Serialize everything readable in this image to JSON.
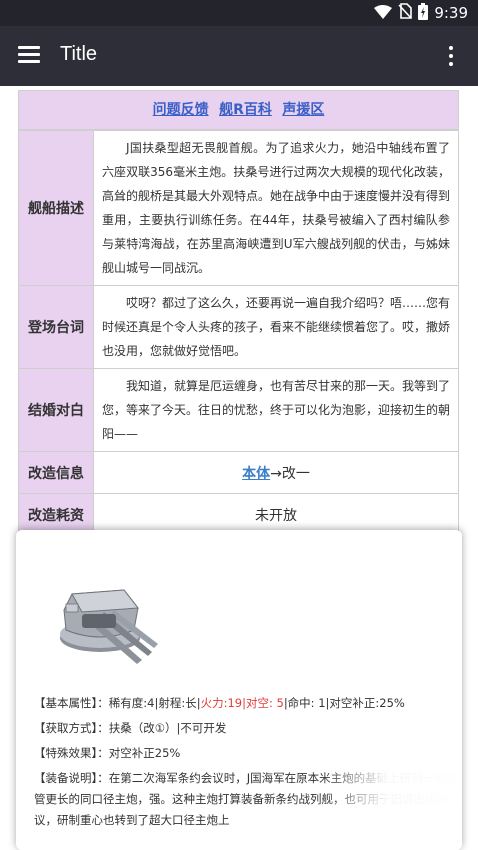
{
  "status_bar": {
    "time": "9:39",
    "icons": [
      "wifi-icon",
      "no-sim-icon",
      "battery-charging-icon"
    ]
  },
  "app_bar": {
    "title": "Title",
    "menu_icon": "hamburger-menu-icon",
    "more_icon": "more-vertical-icon"
  },
  "header_links": [
    "问题反馈",
    "舰R百科",
    "声援区"
  ],
  "rows": {
    "ship_desc": {
      "label": "舰船描述",
      "text": "J国扶桑型超无畏舰首舰。为了追求火力，她沿中轴线布置了六座双联356毫米主炮。扶桑号进行过两次大规模的现代化改装，高耸的舰桥是其最大外观特点。她在战争中由于速度慢并没有得到重用，主要执行训练任务。在44年，扶桑号被编入了西村编队参与莱特湾海战，在苏里高海峡遭到U军六艘战列舰的伏击，与姊妹舰山城号一同战沉。"
    },
    "intro_line": {
      "label": "登场台词",
      "text": "哎呀？都过了这么久，还要再说一遍自我介绍吗？唔……您有时候还真是个令人头疼的孩子，看来不能继续惯着您了。哎，撒娇也没用，您就做好觉悟吧。"
    },
    "marriage_line": {
      "label": "结婚对白",
      "text": "我知道，就算是厄运缠身，也有苦尽甘来的那一天。我等到了您，等来了今天。往日的忧愁，终于可以化为泡影，迎接初生的朝阳——"
    },
    "remodel_info": {
      "label": "改造信息",
      "link": "本体",
      "rest": "→改一"
    },
    "remodel_cost": {
      "label": "改造耗资",
      "value": "未开放"
    }
  },
  "popup": {
    "image_name": "triple-gun-turret-image",
    "basic_attr_label": "【基本属性】：",
    "basic_attr_part1": "稀有度:4|射程:长|",
    "basic_attr_red": "火力:19|对空: 5",
    "basic_attr_part2": "|命中: 1|对空补正:25%",
    "obtain_label": "【获取方式】：",
    "obtain_value": "扶桑（改①）|不可开发",
    "effect_label": "【特殊效果】：",
    "effect_value": "对空补正25%",
    "note_label": "【装备说明】：",
    "note_value": "在第二次海军条约会议时，J国海军在原本米主炮的基础上研制一种身管更长的同口径主炮，强。这种主炮打算装备新条约战列舰，也可用于旧退出国际会议，研制重心也转到了超大口径主炮上"
  },
  "colors": {
    "status_bar": "#23242c",
    "app_bar": "#2d2e37",
    "label_bg": "#e8d2f0",
    "link_blue": "#3a5fc8",
    "highlight_red": "#e23b3b"
  }
}
